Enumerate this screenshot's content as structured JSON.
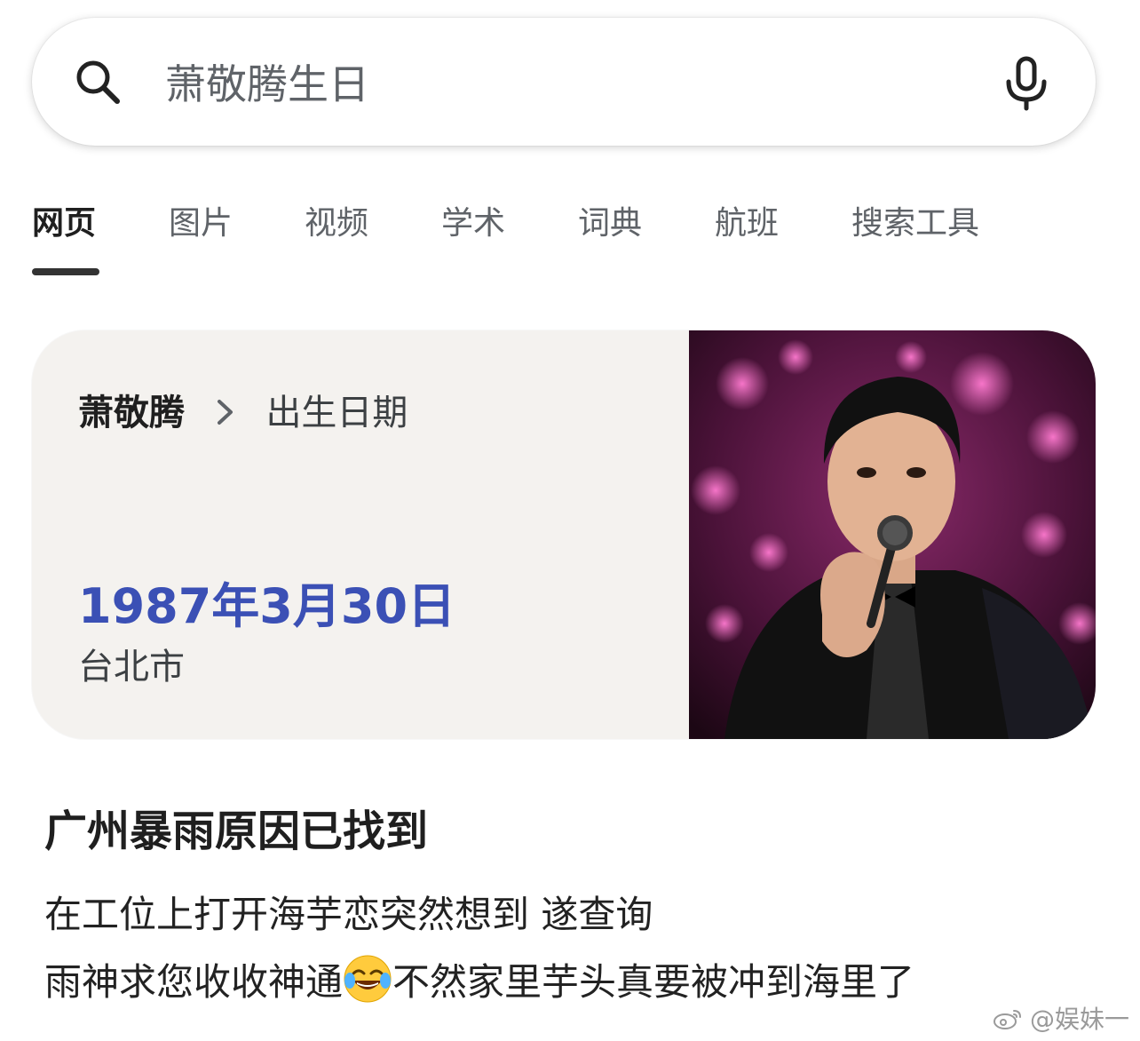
{
  "search": {
    "query": "萧敬腾生日",
    "icons": {
      "search": "search-icon",
      "mic": "mic-icon"
    }
  },
  "tabs": [
    {
      "label": "网页",
      "active": true
    },
    {
      "label": "图片",
      "active": false
    },
    {
      "label": "视频",
      "active": false
    },
    {
      "label": "学术",
      "active": false
    },
    {
      "label": "词典",
      "active": false
    },
    {
      "label": "航班",
      "active": false
    },
    {
      "label": "搜索工具",
      "active": false
    }
  ],
  "knowledge_card": {
    "entity": "萧敬腾",
    "separator_icon": "chevron-right-icon",
    "attribute": "出生日期",
    "answer": "1987年3月30日",
    "place": "台北市",
    "answer_color": "#3b50b5",
    "image": "photo of singer holding microphone on stage"
  },
  "post": {
    "title": "广州暴雨原因已找到",
    "line1": "在工位上打开海芋恋突然想到 遂查询",
    "line2_before": "雨神求您收收神通",
    "emoji": "face-with-tears-of-joy-emoji",
    "line2_after": "不然家里芋头真要被冲到海里了"
  },
  "watermark": {
    "icon": "weibo-icon",
    "text": "@娱妹一"
  }
}
